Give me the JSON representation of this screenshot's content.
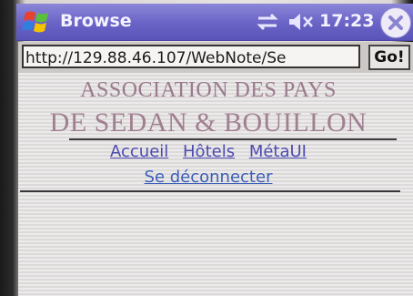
{
  "titlebar": {
    "app_title": "Browse",
    "time": "17:23",
    "colors": {
      "bar": "#6a63c6",
      "text": "#f4f2ff"
    },
    "icons": [
      "windows-flag-icon",
      "connectivity-icon",
      "volume-muted-icon",
      "close-icon"
    ]
  },
  "addressbar": {
    "url": "http://129.88.46.107/WebNote/Se",
    "go_label": "Go!"
  },
  "page": {
    "banner_line1": "ASSOCIATION DES PAYS",
    "banner_line2": "DE SEDAN & BOUILLON",
    "nav": [
      "Accueil",
      "Hôtels",
      "MétaUI"
    ],
    "logout": "Se déconnecter",
    "colors": {
      "banner": "#9a7a8c",
      "link": "#4c4ab0"
    }
  }
}
